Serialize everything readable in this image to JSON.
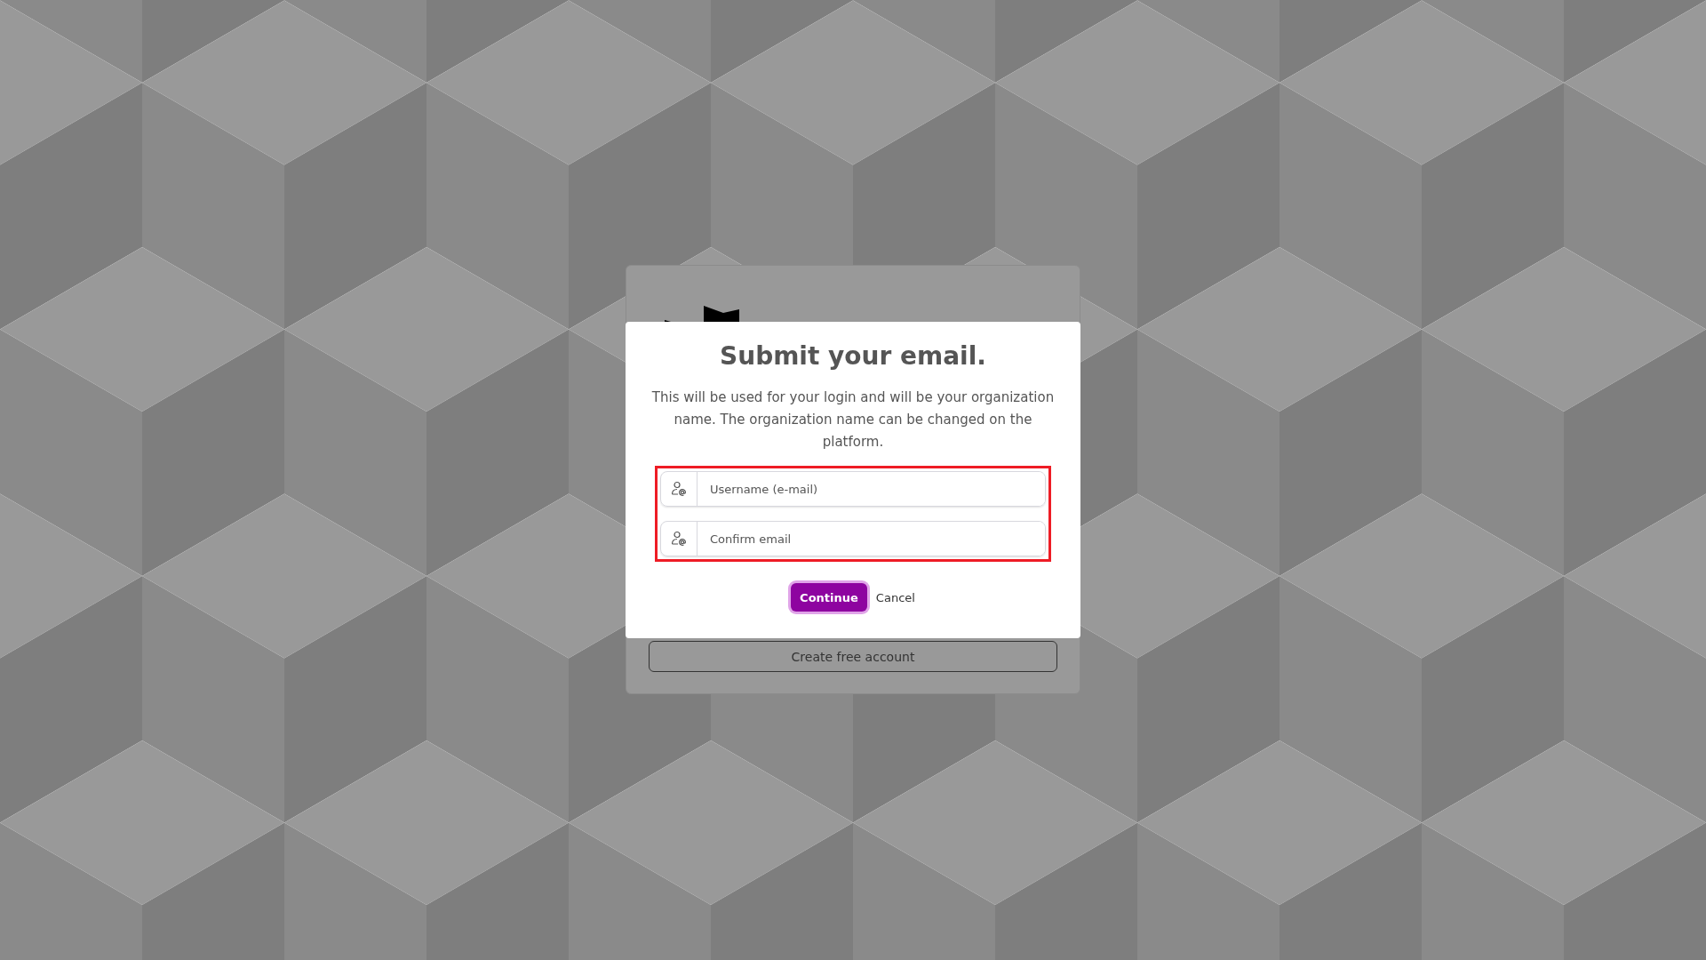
{
  "background_card": {
    "button": "Create free account"
  },
  "dialog": {
    "title": "Submit your email.",
    "message": "This will be used for your login and will be your organization name. The organization name can be changed on the platform.",
    "fields_highlighted": true,
    "fields": [
      {
        "placeholder": "Username (e-mail)"
      },
      {
        "placeholder": "Confirm email"
      }
    ],
    "buttons": [
      {
        "label": "Continue",
        "kind": "primary"
      },
      {
        "label": "Cancel",
        "kind": "link"
      }
    ]
  }
}
